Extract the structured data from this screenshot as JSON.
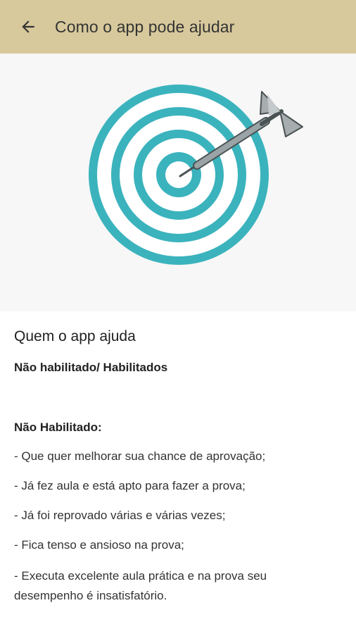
{
  "header": {
    "title": "Como o app pode ajudar",
    "back_icon": "arrow-left-icon",
    "background_color": "#d7c99c"
  },
  "hero": {
    "icon": "target-with-dart-icon",
    "ring_color": "#3bb3bd",
    "dart_color": "#8a9496"
  },
  "content": {
    "section_title": "Quem o app ajuda",
    "subtitle": "Não habilitado/ Habilitados",
    "group_title": "Não Habilitado:",
    "items": [
      "- Que quer melhorar sua chance de aprovação;",
      "- Já fez aula e está apto para fazer a prova;",
      "- Já foi reprovado várias e várias vezes;",
      "- Fica tenso e ansioso na prova;",
      "- Executa excelente aula prática e na prova seu desempenho é insatisfatório."
    ]
  }
}
